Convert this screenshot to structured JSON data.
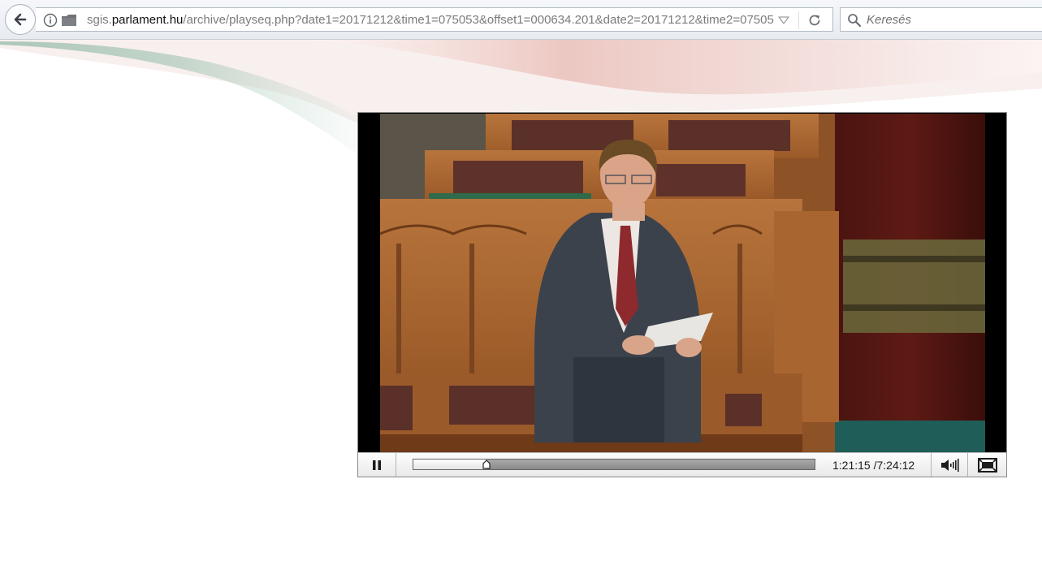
{
  "browser": {
    "url": {
      "prefix": "sgis.",
      "host": "parlament.hu",
      "path": "/archive/playseq.php?date1=20171212&time1=075053&offset1=000634.201&date2=20171212&time2=07505"
    },
    "search": {
      "placeholder": "Keresés"
    },
    "icons": [
      "back-arrow-icon",
      "info-icon",
      "page-icon",
      "dropdown-arrow-icon",
      "reload-icon",
      "search-icon"
    ]
  },
  "player": {
    "current_time": "1:21:15",
    "separator": " /",
    "total_time": "7:24:12",
    "progress_fraction": 0.183,
    "is_playing": true,
    "icons": [
      "pause-icon",
      "volume-icon",
      "fullscreen-icon"
    ]
  },
  "colors": {
    "flag_red": "#d8a8a0",
    "flag_green": "#8fb8a4",
    "controls_bg": "#efefef"
  }
}
